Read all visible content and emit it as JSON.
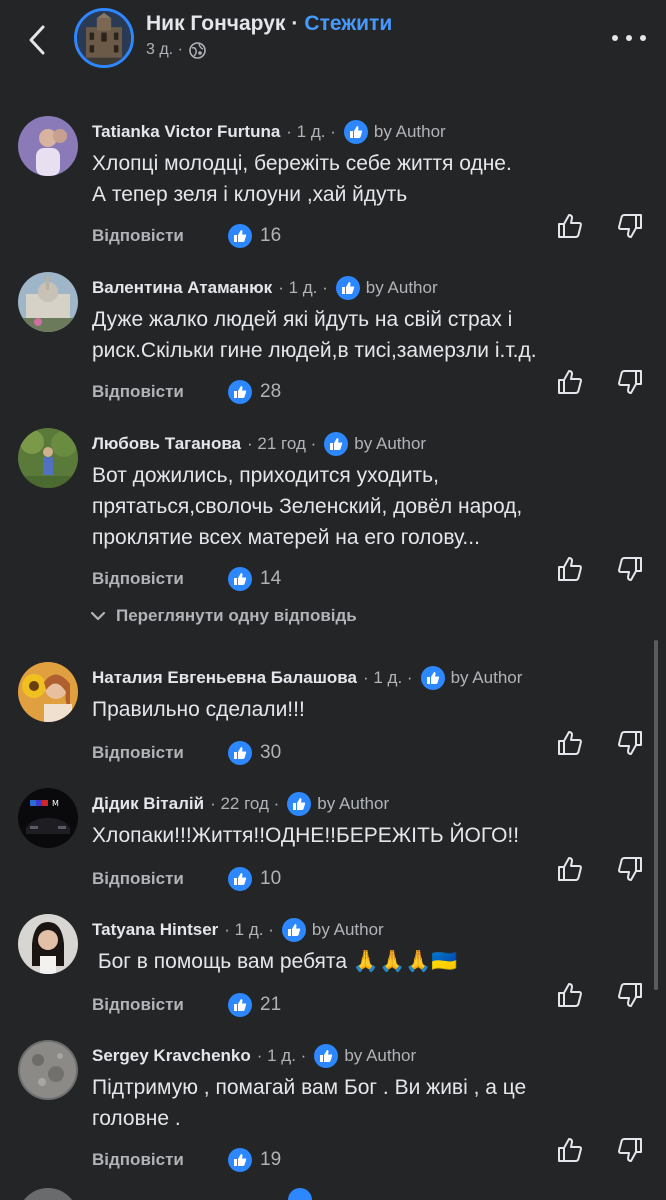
{
  "header": {
    "page_name": "Ник Гончарук",
    "separator": "·",
    "follow_label": "Стежити",
    "post_time": "3 д. ·"
  },
  "comments": [
    {
      "name": "Tatianka Victor Furtuna",
      "time": "· 1 д. ·",
      "badge_label": "by Author",
      "text_lines": [
        "Хлопці молодці, бережіть себе життя одне.",
        "А тепер зеля і клоуни ,хай йдуть"
      ],
      "reply_label": "Відповісти",
      "likes": "16"
    },
    {
      "name": "Валентина Атаманюк",
      "time": "· 1 д. ·",
      "badge_label": "by Author",
      "text_lines": [
        "Дуже жалко людей які йдуть на свій страх і",
        "риск.Скільки гине людей,в тисі,замерзли і.т.д."
      ],
      "reply_label": "Відповісти",
      "likes": "28"
    },
    {
      "name": "Любовь Таганова",
      "time": "· 21 год ·",
      "badge_label": "by Author",
      "text_lines": [
        "Вот дожились, приходится уходить,",
        "прятаться,сволочь Зеленский, довёл народ,",
        "проклятие всех матерей на его голову..."
      ],
      "reply_label": "Відповісти",
      "likes": "14"
    },
    {
      "name": "Наталия Евгеньевна Балашова",
      "time": "· 1 д. ·",
      "badge_label": "by Author",
      "text_lines": [
        "Правильно сделали!!!"
      ],
      "reply_label": "Відповісти",
      "likes": "30"
    },
    {
      "name": "Дідик Віталій",
      "time": "· 22 год ·",
      "badge_label": "by Author",
      "text_lines": [
        "Хлопаки!!!Життя!!ОДНЕ!!БЕРЕЖІТЬ ЙОГО!!"
      ],
      "reply_label": "Відповісти",
      "likes": "10"
    },
    {
      "name": "Tatyana Hintser",
      "time": "· 1 д. ·",
      "badge_label": "by Author",
      "text_lines": [
        " Бог в помощь вам ребята 🙏🙏🙏🇺🇦"
      ],
      "reply_label": "Відповісти",
      "likes": "21"
    },
    {
      "name": "Sergey Kravchenko",
      "time": "· 1 д. ·",
      "badge_label": "by Author",
      "text_lines": [
        "Підтримую , помагай вам Бог . Ви живі , а це",
        "головне ."
      ],
      "reply_label": "Відповісти",
      "likes": "19"
    }
  ],
  "view_replies_label": "Переглянути одну відповідь",
  "colors": {
    "background": "#242526",
    "text": "#e4e6eb",
    "secondary_text": "#b0b3b8",
    "accent": "#2d88ff",
    "link": "#4599ff"
  }
}
